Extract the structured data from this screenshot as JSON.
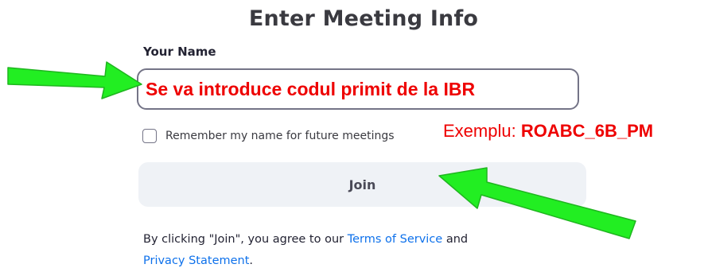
{
  "dialog": {
    "title": "Enter Meeting Info",
    "name_label": "Your Name",
    "name_value": "Se va introduce codul primit de la IBR",
    "remember_label": "Remember my name for future meetings",
    "join_label": "Join",
    "terms_prefix": "By clicking \"Join\", you agree to our",
    "terms_link": "Terms of Service",
    "terms_and": "and",
    "privacy_link": "Privacy Statement",
    "terms_suffix": "."
  },
  "annotation": {
    "example_prefix": "Exemplu:",
    "example_code": "ROABC_6B_PM"
  },
  "colors": {
    "annotation_red": "#ee0000",
    "arrow_green": "#22ee22",
    "link_blue": "#0e71eb",
    "button_bg": "#eff2f6"
  }
}
